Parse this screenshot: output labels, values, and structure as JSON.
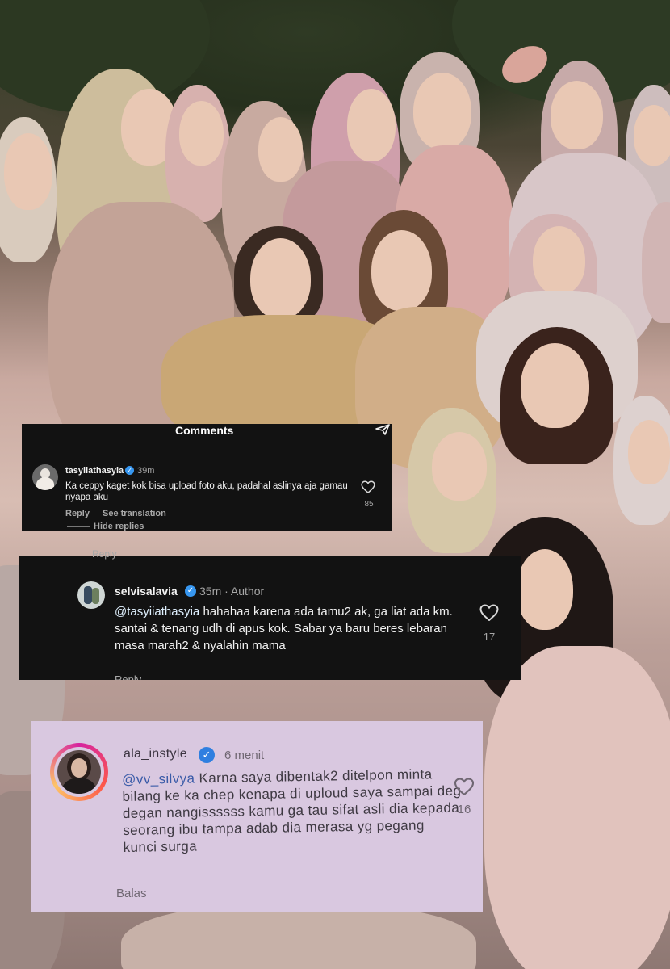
{
  "photo": {
    "label": "group-photo-background"
  },
  "comments_panel": {
    "title": "Comments",
    "comment": {
      "username": "tasyiiathasyia",
      "time": "39m",
      "text": "Ka ceppy kaget kok bisa upload foto aku, padahal aslinya aja gamau nyapa aku",
      "reply_label": "Reply",
      "translate_label": "See translation",
      "likes": "85",
      "hide_replies_label": "Hide replies"
    }
  },
  "reply_panel": {
    "cut_top_label": "Reply",
    "username": "selvisalavia",
    "time": "35m · Author",
    "mention": "@tasyiiathasyia",
    "text": " hahahaa karena ada tamu2 ak, ga liat ada km. santai & tenang udh di apus kok. Sabar ya baru beres lebaran masa marah2 & nyalahin mama",
    "likes": "17",
    "cut_bottom_label": "Reply"
  },
  "photo_comment_panel": {
    "username": "ala_instyle",
    "time": "6 menit",
    "mention": "@vv_silvya",
    "text": " Karna saya dibentak2 ditelpon minta  bilang ke ka chep kenapa di uploud  saya sampai deg degan nangissssss  kamu ga tau sifat asli dia kepada seorang  ibu  tampa adab dia merasa yg pegang kunci surga",
    "likes": "16",
    "reply_label": "Balas"
  },
  "colors": {
    "dark_panel": "#121212",
    "verified_blue": "#3797f0",
    "muted_text": "#a8a8a8",
    "photo_panel": "#d9c8e0"
  }
}
